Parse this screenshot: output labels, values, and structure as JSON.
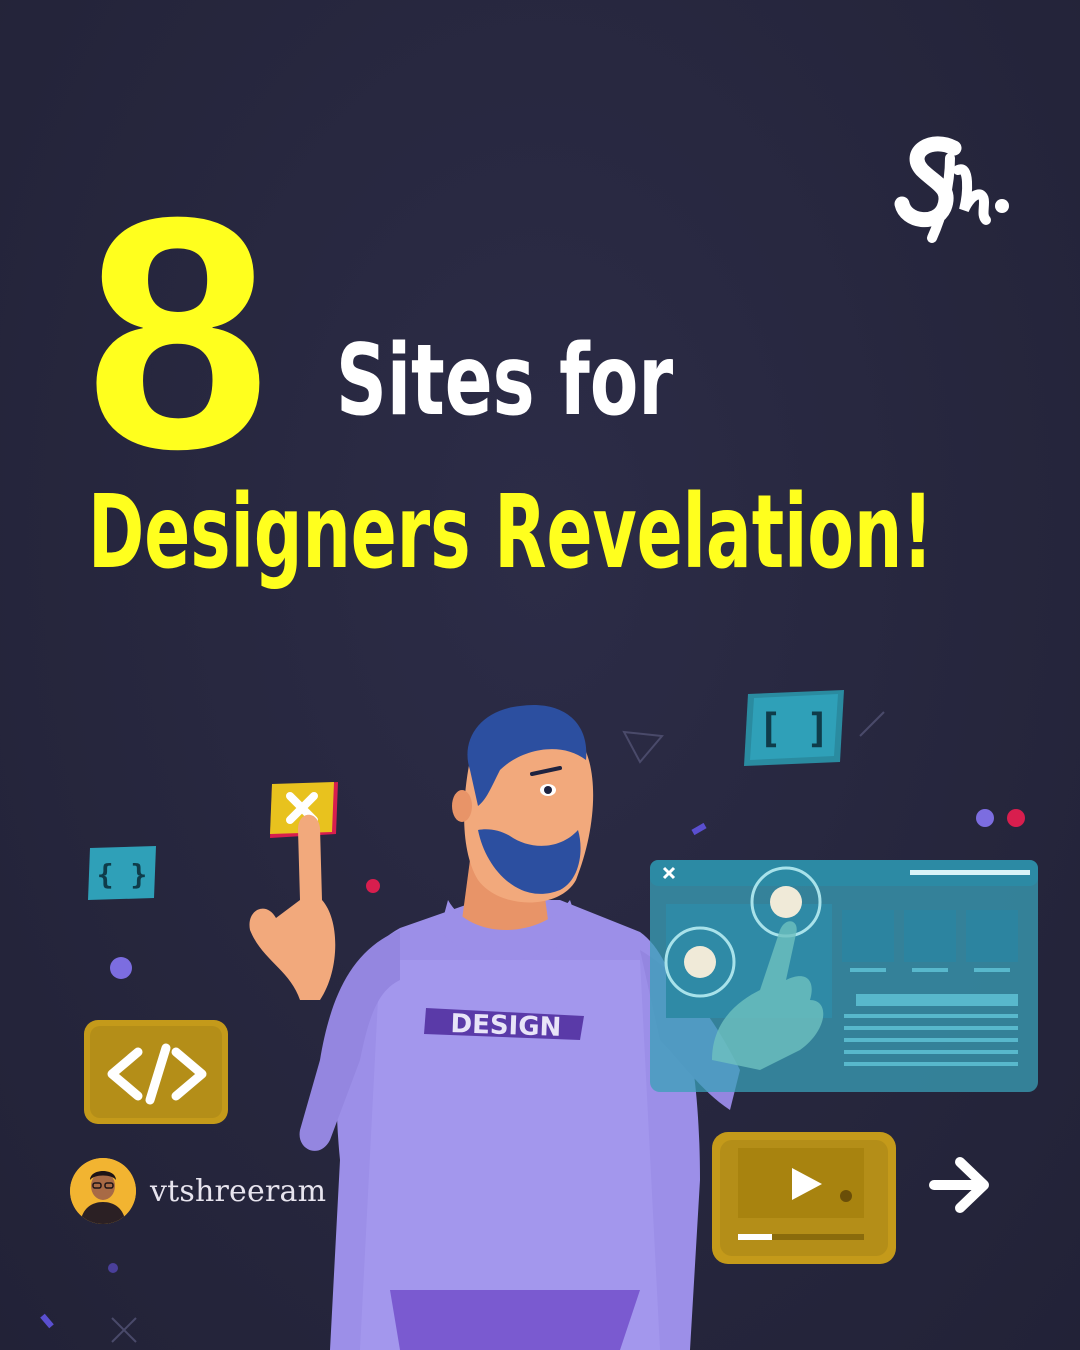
{
  "post": {
    "number": "8",
    "headline_line1": "Sites for",
    "headline_line2": "Designers Revelation!"
  },
  "illustration": {
    "sweater_text": "DESIGN"
  },
  "author": {
    "handle": "vtshreeram"
  },
  "colors": {
    "background": "#27273f",
    "accent_yellow": "#ffff1e",
    "text_white": "#ffffff"
  },
  "icons": [
    "brand-logo-icon",
    "close-icon",
    "brackets-icon",
    "curly-braces-icon",
    "code-icon",
    "gear-icon",
    "video-player-icon",
    "next-arrow-icon"
  ]
}
